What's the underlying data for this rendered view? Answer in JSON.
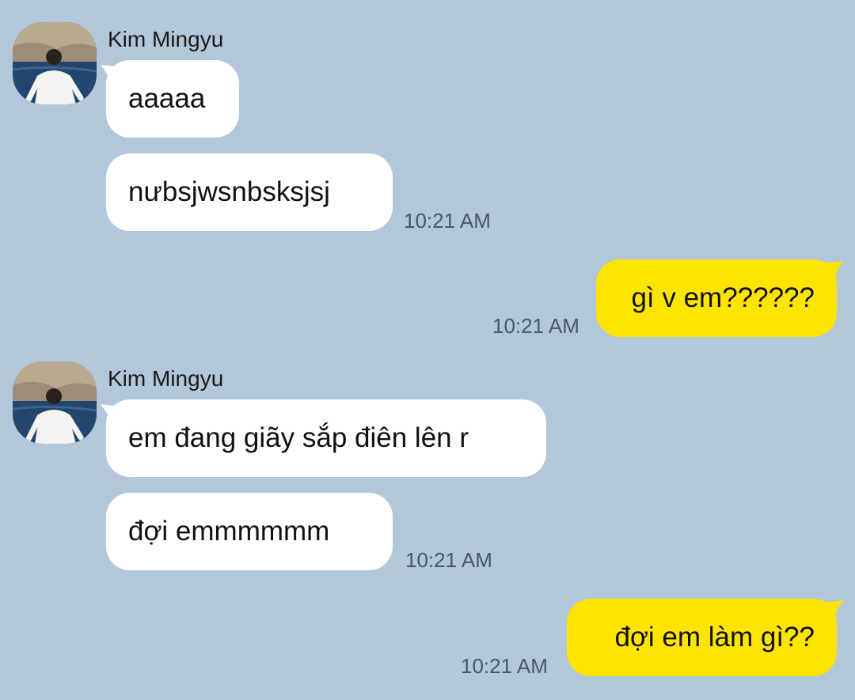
{
  "colors": {
    "background": "#b2c7da",
    "incoming_bubble": "#ffffff",
    "outgoing_bubble": "#fee500",
    "timestamp": "#4a5864"
  },
  "messages": [
    {
      "sender": "Kim Mingyu",
      "avatar_icon": "profile-photo",
      "bubbles": [
        "aaaaa",
        "nưbsjwsnbsksjsj"
      ],
      "time": "10:21 AM"
    },
    {
      "outgoing": true,
      "bubbles": [
        "gì v em??????"
      ],
      "time": "10:21 AM"
    },
    {
      "sender": "Kim Mingyu",
      "avatar_icon": "profile-photo",
      "bubbles": [
        "em đang giãy sắp điên lên r",
        "đợi emmmmmm"
      ],
      "time": "10:21 AM"
    },
    {
      "outgoing": true,
      "bubbles": [
        "đợi em làm gì??"
      ],
      "time": "10:21 AM"
    }
  ]
}
